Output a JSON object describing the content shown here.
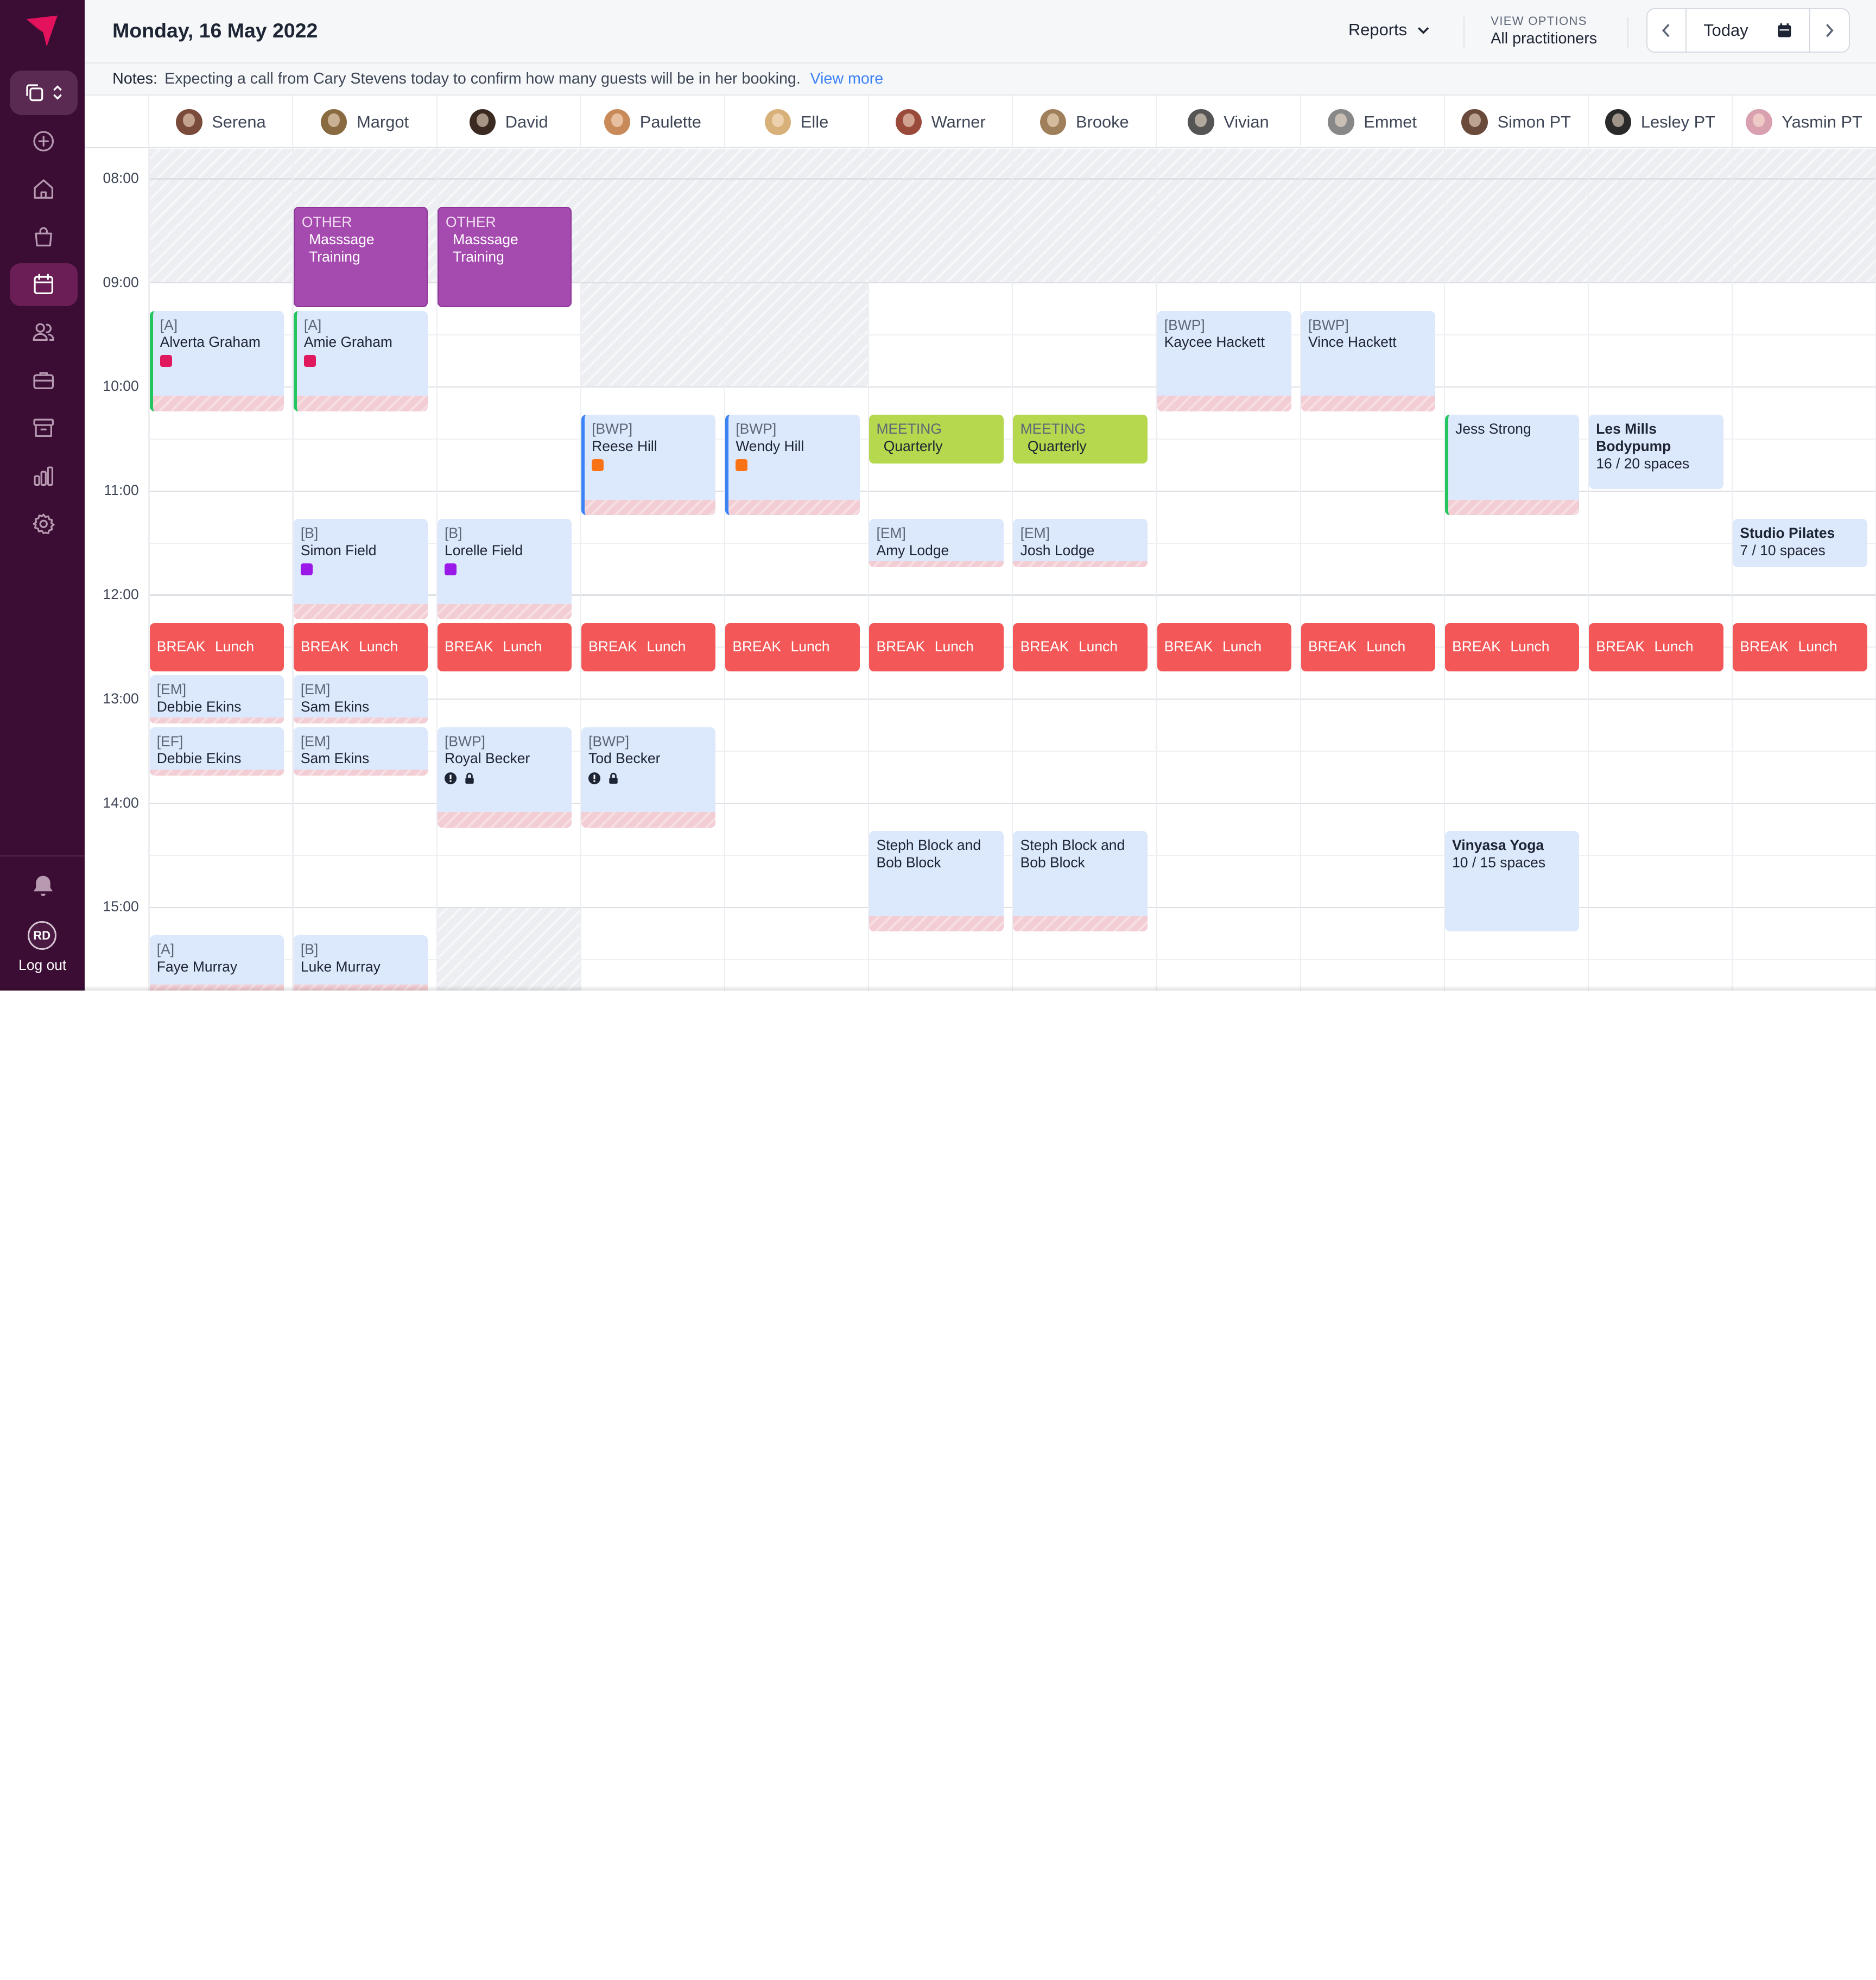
{
  "header": {
    "date": "Monday, 16 May 2022",
    "reports_label": "Reports",
    "view_options_label": "VIEW OPTIONS",
    "view_options_value": "All practitioners",
    "today_label": "Today"
  },
  "notes": {
    "label": "Notes:",
    "text": "Expecting a call from Cary Stevens today to confirm how many guests will be in her booking.",
    "link": "View more"
  },
  "sidebar": {
    "nav": [
      "switcher",
      "add",
      "home",
      "shop",
      "calendar",
      "clients",
      "services",
      "archive",
      "reports",
      "settings"
    ],
    "active": "calendar",
    "user_initials": "RD",
    "logout_label": "Log out"
  },
  "practitioners": [
    "Serena",
    "Margot",
    "David",
    "Paulette",
    "Elle",
    "Warner",
    "Brooke",
    "Vivian",
    "Emmet",
    "Simon PT",
    "Lesley PT",
    "Yasmin PT"
  ],
  "times": [
    "08:00",
    "09:00",
    "10:00",
    "11:00",
    "12:00",
    "13:00",
    "14:00",
    "15:00"
  ],
  "colors": {
    "sidebar": "#3b0d34",
    "accent": "#e4125d",
    "appointment": "#dce8fb",
    "other": "#a54aae",
    "meeting": "#b6d84e",
    "break": "#f35757",
    "link": "#3b82f6"
  },
  "events": [
    {
      "col": 1,
      "start": "08:15",
      "end": "09:15",
      "type": "other",
      "tag": "OTHER",
      "name": "Masssage Training"
    },
    {
      "col": 2,
      "start": "08:15",
      "end": "09:15",
      "type": "other",
      "tag": "OTHER",
      "name": "Masssage Training"
    },
    {
      "col": 0,
      "start": "09:15",
      "end": "10:15",
      "type": "appt",
      "bar": "green",
      "tag": "[A]",
      "name": "Alverta Graham",
      "marker": "#e0195f"
    },
    {
      "col": 1,
      "start": "09:15",
      "end": "10:15",
      "type": "appt",
      "bar": "green",
      "tag": "[A]",
      "name": "Amie Graham",
      "marker": "#e0195f"
    },
    {
      "col": 7,
      "start": "09:15",
      "end": "10:15",
      "type": "appt",
      "tag": "[BWP]",
      "name": "Kaycee Hackett"
    },
    {
      "col": 8,
      "start": "09:15",
      "end": "10:15",
      "type": "appt",
      "tag": "[BWP]",
      "name": "Vince Hackett"
    },
    {
      "col": 3,
      "start": "10:15",
      "end": "11:15",
      "type": "appt",
      "bar": "blue",
      "tag": "[BWP]",
      "name": "Reese Hill",
      "marker": "#f97316"
    },
    {
      "col": 4,
      "start": "10:15",
      "end": "11:15",
      "type": "appt",
      "bar": "blue",
      "tag": "[BWP]",
      "name": "Wendy Hill",
      "marker": "#f97316"
    },
    {
      "col": 5,
      "start": "10:15",
      "end": "10:45",
      "type": "meeting",
      "tag": "MEETING",
      "name": "Quarterly"
    },
    {
      "col": 6,
      "start": "10:15",
      "end": "10:45",
      "type": "meeting",
      "tag": "MEETING",
      "name": "Quarterly"
    },
    {
      "col": 9,
      "start": "10:15",
      "end": "11:15",
      "type": "appt",
      "bar": "green",
      "tag": "",
      "name": "Jess Strong"
    },
    {
      "col": 10,
      "start": "10:15",
      "end": "11:00",
      "type": "class",
      "name": "Les Mills Bodypump",
      "capacity": "16 / 20 spaces"
    },
    {
      "col": 1,
      "start": "11:15",
      "end": "12:15",
      "type": "appt",
      "tag": "[B]",
      "name": "Simon Field",
      "marker": "#9b19e8"
    },
    {
      "col": 2,
      "start": "11:15",
      "end": "12:15",
      "type": "appt",
      "tag": "[B]",
      "name": "Lorelle Field",
      "marker": "#9b19e8"
    },
    {
      "col": 5,
      "start": "11:15",
      "end": "11:45",
      "type": "appt",
      "tag": "[EM]",
      "name": "Amy Lodge"
    },
    {
      "col": 6,
      "start": "11:15",
      "end": "11:45",
      "type": "appt",
      "tag": "[EM]",
      "name": "Josh Lodge"
    },
    {
      "col": 11,
      "start": "11:15",
      "end": "11:45",
      "type": "class",
      "name": "Studio Pilates",
      "capacity": "7 / 10 spaces"
    },
    {
      "col": 0,
      "start": "12:15",
      "end": "12:45",
      "type": "break",
      "tag": "BREAK",
      "name": "Lunch"
    },
    {
      "col": 1,
      "start": "12:15",
      "end": "12:45",
      "type": "break",
      "tag": "BREAK",
      "name": "Lunch"
    },
    {
      "col": 2,
      "start": "12:15",
      "end": "12:45",
      "type": "break",
      "tag": "BREAK",
      "name": "Lunch"
    },
    {
      "col": 3,
      "start": "12:15",
      "end": "12:45",
      "type": "break",
      "tag": "BREAK",
      "name": "Lunch"
    },
    {
      "col": 4,
      "start": "12:15",
      "end": "12:45",
      "type": "break",
      "tag": "BREAK",
      "name": "Lunch"
    },
    {
      "col": 5,
      "start": "12:15",
      "end": "12:45",
      "type": "break",
      "tag": "BREAK",
      "name": "Lunch"
    },
    {
      "col": 6,
      "start": "12:15",
      "end": "12:45",
      "type": "break",
      "tag": "BREAK",
      "name": "Lunch"
    },
    {
      "col": 7,
      "start": "12:15",
      "end": "12:45",
      "type": "break",
      "tag": "BREAK",
      "name": "Lunch"
    },
    {
      "col": 8,
      "start": "12:15",
      "end": "12:45",
      "type": "break",
      "tag": "BREAK",
      "name": "Lunch"
    },
    {
      "col": 9,
      "start": "12:15",
      "end": "12:45",
      "type": "break",
      "tag": "BREAK",
      "name": "Lunch"
    },
    {
      "col": 10,
      "start": "12:15",
      "end": "12:45",
      "type": "break",
      "tag": "BREAK",
      "name": "Lunch"
    },
    {
      "col": 11,
      "start": "12:15",
      "end": "12:45",
      "type": "break",
      "tag": "BREAK",
      "name": "Lunch"
    },
    {
      "col": 0,
      "start": "12:45",
      "end": "13:15",
      "type": "appt",
      "tag": "[EM]",
      "name": "Debbie Ekins"
    },
    {
      "col": 1,
      "start": "12:45",
      "end": "13:15",
      "type": "appt",
      "tag": "[EM]",
      "name": "Sam Ekins"
    },
    {
      "col": 0,
      "start": "13:15",
      "end": "13:45",
      "type": "appt",
      "tag": "[EF]",
      "name": "Debbie Ekins"
    },
    {
      "col": 1,
      "start": "13:15",
      "end": "13:45",
      "type": "appt",
      "tag": "[EM]",
      "name": "Sam Ekins"
    },
    {
      "col": 2,
      "start": "13:15",
      "end": "14:15",
      "type": "appt",
      "tag": "[BWP]",
      "name": "Royal Becker",
      "icons": true
    },
    {
      "col": 3,
      "start": "13:15",
      "end": "14:15",
      "type": "appt",
      "tag": "[BWP]",
      "name": "Tod Becker",
      "icons": true
    },
    {
      "col": 5,
      "start": "14:15",
      "end": "15:15",
      "type": "appt",
      "tag": "",
      "name": "Steph Block and Bob Block"
    },
    {
      "col": 6,
      "start": "14:15",
      "end": "15:15",
      "type": "appt",
      "tag": "",
      "name": "Steph Block and Bob Block"
    },
    {
      "col": 9,
      "start": "14:15",
      "end": "15:15",
      "type": "class",
      "name": "Vinyasa Yoga",
      "capacity": "10 / 15 spaces"
    },
    {
      "col": 0,
      "start": "15:15",
      "end": "16:15",
      "type": "appt",
      "tag": "[A]",
      "name": "Faye Murray"
    },
    {
      "col": 1,
      "start": "15:15",
      "end": "16:15",
      "type": "appt",
      "tag": "[B]",
      "name": "Luke Murray"
    }
  ]
}
